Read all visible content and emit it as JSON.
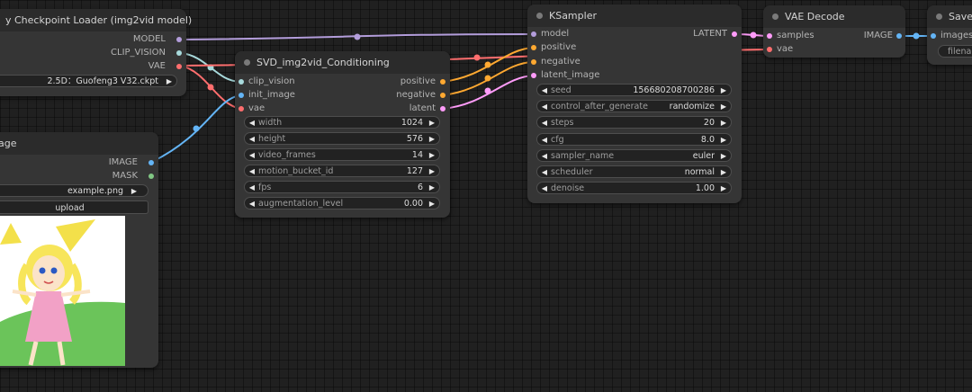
{
  "colors": {
    "model": "#b39ddb",
    "clip_vision": "#a8dadc",
    "vae": "#ff6e6e",
    "image": "#64b5f6",
    "conditioning": "#ffa931",
    "latent": "#ff9cf9",
    "mask": "#81c784"
  },
  "loader": {
    "title": "y Checkpoint Loader (img2vid model)",
    "outputs": [
      "MODEL",
      "CLIP_VISION",
      "VAE"
    ],
    "ckpt_value": "2.5D：Guofeng3 V32.ckpt"
  },
  "load_image": {
    "title": "age",
    "outputs": [
      "IMAGE",
      "MASK"
    ],
    "image_value": "example.png",
    "upload_label": "upload"
  },
  "svd": {
    "title": "SVD_img2vid_Conditioning",
    "inputs": [
      "clip_vision",
      "init_image",
      "vae"
    ],
    "outputs": [
      "positive",
      "negative",
      "latent"
    ],
    "widgets": [
      {
        "label": "width",
        "value": "1024"
      },
      {
        "label": "height",
        "value": "576"
      },
      {
        "label": "video_frames",
        "value": "14"
      },
      {
        "label": "motion_bucket_id",
        "value": "127"
      },
      {
        "label": "fps",
        "value": "6"
      },
      {
        "label": "augmentation_level",
        "value": "0.00"
      }
    ]
  },
  "ksampler": {
    "title": "KSampler",
    "inputs": [
      "model",
      "positive",
      "negative",
      "latent_image"
    ],
    "output": "LATENT",
    "widgets": [
      {
        "label": "seed",
        "value": "156680208700286"
      },
      {
        "label": "control_after_generate",
        "value": "randomize"
      },
      {
        "label": "steps",
        "value": "20"
      },
      {
        "label": "cfg",
        "value": "8.0"
      },
      {
        "label": "sampler_name",
        "value": "euler"
      },
      {
        "label": "scheduler",
        "value": "normal"
      },
      {
        "label": "denoise",
        "value": "1.00"
      }
    ]
  },
  "vae_decode": {
    "title": "VAE Decode",
    "inputs": [
      "samples",
      "vae"
    ],
    "output": "IMAGE"
  },
  "save": {
    "title": "Save",
    "inputs": [
      "images"
    ],
    "filename_value": "filenam"
  }
}
